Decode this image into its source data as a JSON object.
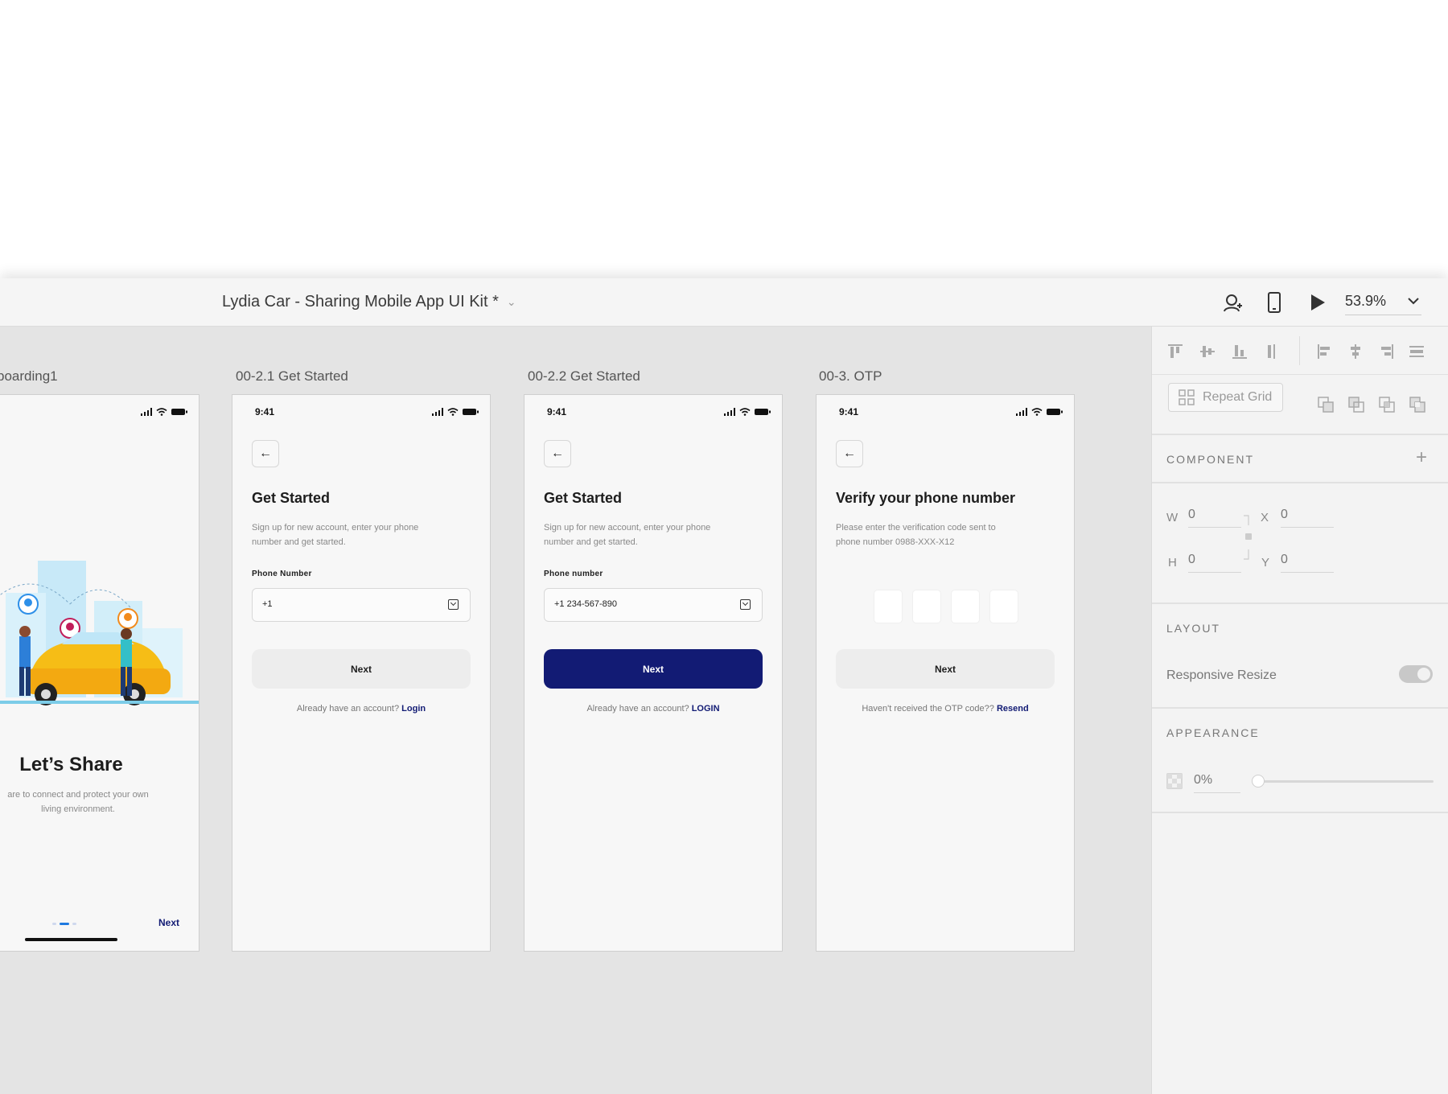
{
  "window": {
    "title": "Lydia Car - Sharing Mobile App UI Kit *",
    "zoom": "53.9%"
  },
  "artboards": [
    {
      "label": "boarding1",
      "title": "Let’s Share",
      "subtitle": "are to connect and protect your own living environment.",
      "next": "Next"
    },
    {
      "label": "00-2.1 Get Started",
      "time": "9:41",
      "title": "Get Started",
      "subtitle": "Sign up for new account, enter your phone number and get started.",
      "field_label": "Phone Number",
      "field_value": "+1",
      "button": "Next",
      "footer": "Already have an account?",
      "footer_link": "Login"
    },
    {
      "label": "00-2.2 Get Started",
      "time": "9:41",
      "title": "Get Started",
      "subtitle": "Sign up for new account, enter your phone number and get started.",
      "field_label": "Phone number",
      "field_value": "+1 234-567-890",
      "button": "Next",
      "footer": "Already have an account?",
      "footer_link": "LOGIN"
    },
    {
      "label": "00-3. OTP",
      "time": "9:41",
      "title": "Verify your phone number",
      "subtitle": "Please enter the verification code sent to phone number 0988-XXX-X12",
      "button": "Next",
      "footer": "Haven't received the OTP code??",
      "footer_link": "Resend"
    }
  ],
  "panel": {
    "repeat_grid": "Repeat Grid",
    "component": "COMPONENT",
    "w_label": "W",
    "w_value": "0",
    "h_label": "H",
    "h_value": "0",
    "x_label": "X",
    "x_value": "0",
    "y_label": "Y",
    "y_value": "0",
    "layout": "LAYOUT",
    "responsive_resize": "Responsive Resize",
    "appearance": "APPEARANCE",
    "opacity": "0%"
  },
  "colors": {
    "accent": "#121b74",
    "dot_active": "#1f7ae0"
  }
}
